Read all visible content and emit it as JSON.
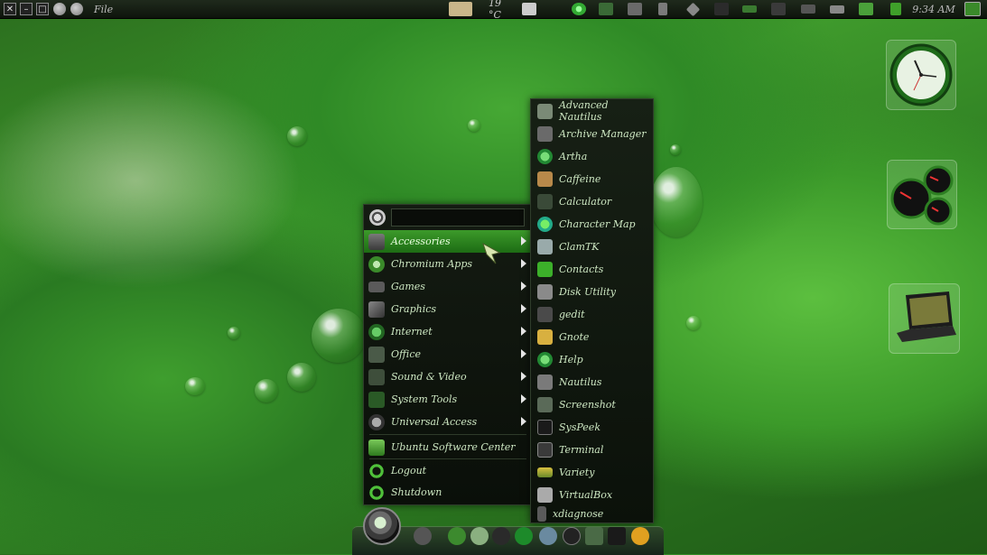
{
  "top_panel": {
    "file_label": "File",
    "temperature": "19 °C",
    "time": "9:34 AM",
    "window_buttons": [
      "✕",
      "–",
      "□"
    ]
  },
  "search": {
    "placeholder": ""
  },
  "categories": [
    {
      "label": "Accessories",
      "has_submenu": true,
      "active": true,
      "icon": "accessories-icon"
    },
    {
      "label": "Chromium Apps",
      "has_submenu": true,
      "icon": "chromium-icon"
    },
    {
      "label": "Games",
      "has_submenu": true,
      "icon": "games-icon"
    },
    {
      "label": "Graphics",
      "has_submenu": true,
      "icon": "graphics-icon"
    },
    {
      "label": "Internet",
      "has_submenu": true,
      "icon": "internet-icon"
    },
    {
      "label": "Office",
      "has_submenu": true,
      "icon": "office-icon"
    },
    {
      "label": "Sound & Video",
      "has_submenu": true,
      "icon": "sound-video-icon"
    },
    {
      "label": "System Tools",
      "has_submenu": true,
      "icon": "system-tools-icon"
    },
    {
      "label": "Universal Access",
      "has_submenu": true,
      "icon": "universal-access-icon"
    }
  ],
  "actions": [
    {
      "label": "Ubuntu Software Center",
      "icon": "software-center-icon"
    },
    {
      "label": "Logout",
      "icon": "logout-icon"
    },
    {
      "label": "Shutdown",
      "icon": "shutdown-icon"
    }
  ],
  "apps": [
    "Advanced Nautilus",
    "Archive Manager",
    "Artha",
    "Caffeine",
    "Calculator",
    "Character Map",
    "ClamTK",
    "Contacts",
    "Disk Utility",
    "gedit",
    "Gnote",
    "Help",
    "Nautilus",
    "Screenshot",
    "SysPeek",
    "Terminal",
    "Variety",
    "VirtualBox",
    "xdiagnose"
  ],
  "colors": {
    "accent": "#3c9a2a",
    "menu_bg": "#0e140c",
    "menu_text": "#cde7c2"
  }
}
